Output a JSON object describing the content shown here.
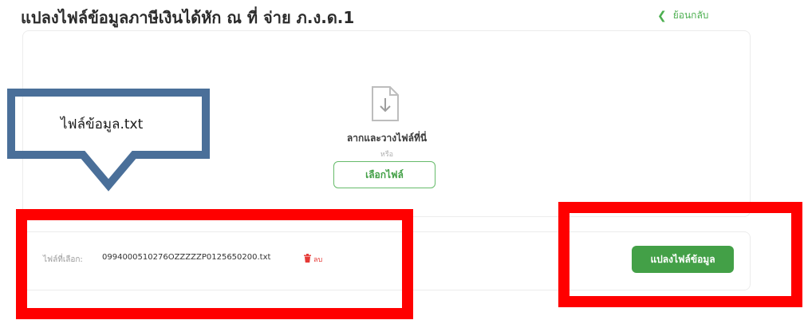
{
  "page": {
    "title": "แปลงไฟล์ข้อมูลภาษีเงินได้หัก ณ ที่ จ่าย ภ.ง.ด.1",
    "back_label": "ย้อนกลับ"
  },
  "upload": {
    "drop_text": "ลากและวางไฟล์ที่นี่",
    "or_text": "หรือ",
    "choose_button": "เลือกไฟล์"
  },
  "selected_file": {
    "label": "ไฟล์ที่เลือก:",
    "name": "0994000510276OZZZZZP0125650200.txt",
    "delete_label": "ลบ"
  },
  "convert_button": "แปลงไฟล์ข้อมูล",
  "annotation": {
    "callout_text": "ไฟล์ข้อมูล.txt"
  },
  "colors": {
    "accent_green": "#43a047",
    "highlight_red": "#ff0000",
    "callout_blue": "#4a6f99",
    "delete_red": "#e53935"
  },
  "icons": [
    "chevron-left-icon",
    "file-download-icon",
    "trash-icon"
  ]
}
